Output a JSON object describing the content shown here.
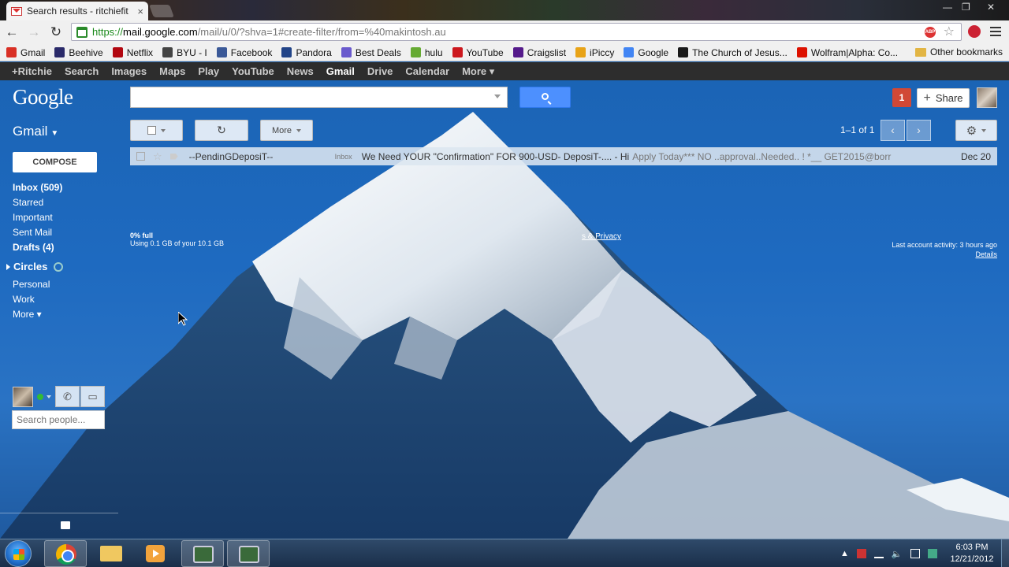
{
  "browser": {
    "tab_title": "Search results - ritchiefit",
    "tab_close": "×",
    "url_scheme": "https://",
    "url_host": "mail.google.com",
    "url_path": "/mail/u/0/?shva=1#create-filter/from=%40makintosh.au",
    "window_controls": [
      "—",
      "❐",
      "✕"
    ]
  },
  "bookmarks": {
    "items": [
      {
        "label": "Gmail",
        "color": "#d93025"
      },
      {
        "label": "Beehive",
        "color": "#2a2a6a"
      },
      {
        "label": "Netflix",
        "color": "#b20710"
      },
      {
        "label": "BYU - I",
        "color": "#444444"
      },
      {
        "label": "Facebook",
        "color": "#3b5998"
      },
      {
        "label": "Pandora",
        "color": "#224488"
      },
      {
        "label": "Best Deals",
        "color": "#6a5acd"
      },
      {
        "label": "hulu",
        "color": "#66aa33"
      },
      {
        "label": "YouTube",
        "color": "#cc181e"
      },
      {
        "label": "Craigslist",
        "color": "#551a8b"
      },
      {
        "label": "iPiccy",
        "color": "#e8a317"
      },
      {
        "label": "Google",
        "color": "#4285f4"
      },
      {
        "label": "The Church of Jesus...",
        "color": "#1a1a1a"
      },
      {
        "label": "Wolfram|Alpha: Co...",
        "color": "#dd1100"
      }
    ],
    "other": "Other bookmarks"
  },
  "gbar": {
    "items": [
      "+Ritchie",
      "Search",
      "Images",
      "Maps",
      "Play",
      "YouTube",
      "News",
      "Gmail",
      "Drive",
      "Calendar",
      "More ▾"
    ],
    "active": "Gmail"
  },
  "header": {
    "logo": "Google",
    "search_value": "",
    "notif_count": "1",
    "share_label": "Share",
    "share_plus": "+"
  },
  "sidebar": {
    "gmail_label": "Gmail",
    "compose": "COMPOSE",
    "items": [
      {
        "label": "Inbox (509)",
        "bold": true
      },
      {
        "label": "Starred",
        "bold": false
      },
      {
        "label": "Important",
        "bold": false
      },
      {
        "label": "Sent Mail",
        "bold": false
      },
      {
        "label": "Drafts (4)",
        "bold": true
      }
    ],
    "circles": "Circles",
    "circle_items": [
      "Personal",
      "Work",
      "More ▾"
    ],
    "people_placeholder": "Search people..."
  },
  "toolbar": {
    "more_label": "More",
    "refresh_icon": "↻",
    "pager": "1–1 of 1",
    "prev": "‹",
    "next": "›",
    "settings_icon": "⚙"
  },
  "mail": {
    "rows": [
      {
        "sender": "--PendinGDeposiT--",
        "label": "Inbox",
        "subject": "We Need YOUR \"Confirmation\" FOR 900-USD- DeposiT-.... - Hi",
        "snippet": "Apply Today*** NO ..approval..Needed.. ! *__ GET2015@borr",
        "date": "Dec 20"
      }
    ]
  },
  "footer": {
    "usage_full": "0% full",
    "usage_detail": "Using 0.1 GB of your 10.1 GB",
    "privacy": "s & Privacy",
    "last_activity": "Last account activity: 3 hours ago",
    "details": "Details"
  },
  "taskbar": {
    "time": "6:03 PM",
    "date": "12/21/2012"
  }
}
